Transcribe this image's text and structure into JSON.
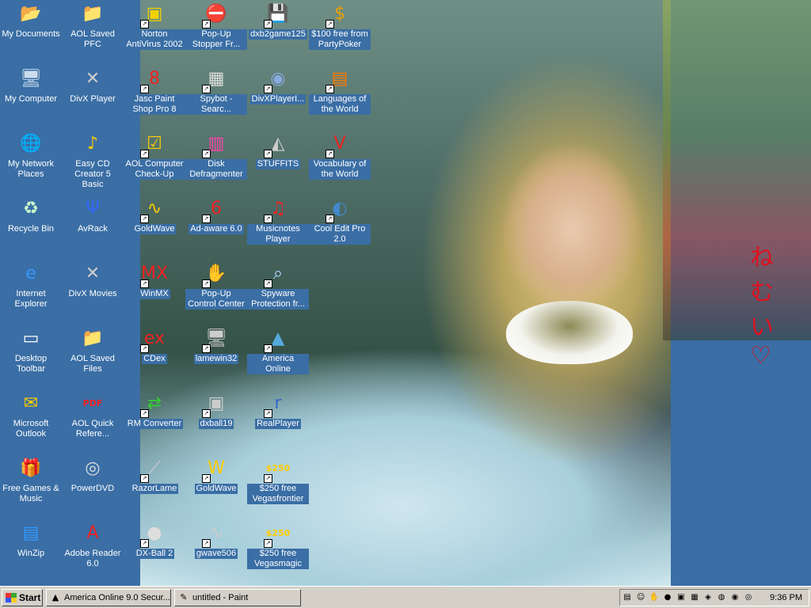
{
  "desktop": {
    "background_color": "#3a6ea5",
    "wallpaper_text": "ねむい♡",
    "icons": [
      {
        "label": "My Documents",
        "icon": "folder-documents-icon",
        "glyph": "📂",
        "color": "#f5d36a"
      },
      {
        "label": "AOL Saved PFC",
        "icon": "folder-icon",
        "glyph": "📁",
        "color": "#f5d36a"
      },
      {
        "label": "Norton AntiVirus 2002",
        "icon": "norton-icon",
        "glyph": "▣",
        "color": "#f2d200"
      },
      {
        "label": "Pop-Up Stopper Fr...",
        "icon": "popup-stopper-icon",
        "glyph": "⛔",
        "color": "#e22"
      },
      {
        "label": "dxb2game125",
        "icon": "installer-icon",
        "glyph": "💾",
        "color": "#ddd"
      },
      {
        "label": "$100 free from PartyPoker",
        "icon": "casino-chip-icon",
        "glyph": "$",
        "color": "#e8a000"
      },
      {
        "label": "My Computer",
        "icon": "computer-icon",
        "glyph": "🖥",
        "color": "#cde"
      },
      {
        "label": "DivX Player",
        "icon": "divx-icon",
        "glyph": "✕",
        "color": "#ccc"
      },
      {
        "label": "Jasc Paint Shop Pro 8",
        "icon": "paintshop-icon",
        "glyph": "8",
        "color": "#e22"
      },
      {
        "label": "Spybot - Searc...",
        "icon": "spybot-icon",
        "glyph": "▦",
        "color": "#ddd"
      },
      {
        "label": "DivXPlayerI...",
        "icon": "installer-disc-icon",
        "glyph": "◉",
        "color": "#8ad"
      },
      {
        "label": "Languages of the World",
        "icon": "languages-icon",
        "glyph": "▤",
        "color": "#f70"
      },
      {
        "label": "My Network Places",
        "icon": "network-icon",
        "glyph": "🌐",
        "color": "#5ad"
      },
      {
        "label": "Easy CD Creator 5 Basic",
        "icon": "cd-creator-icon",
        "glyph": "♪",
        "color": "#fc0"
      },
      {
        "label": "AOL Computer Check-Up",
        "icon": "checkup-icon",
        "glyph": "☑",
        "color": "#fc0"
      },
      {
        "label": "Disk Defragmenter",
        "icon": "defrag-icon",
        "glyph": "▥",
        "color": "#f4a"
      },
      {
        "label": "STUFFITS",
        "icon": "stuffit-icon",
        "glyph": "◭",
        "color": "#ccc"
      },
      {
        "label": "Vocabulary of the World",
        "icon": "vocabulary-icon",
        "glyph": "V",
        "color": "#e22"
      },
      {
        "label": "Recycle Bin",
        "icon": "recycle-bin-icon",
        "glyph": "♻",
        "color": "#cfc"
      },
      {
        "label": "AvRack",
        "icon": "avrack-icon",
        "glyph": "Ψ",
        "color": "#36f"
      },
      {
        "label": "GoldWave",
        "icon": "goldwave-icon",
        "glyph": "∿",
        "color": "#fc0"
      },
      {
        "label": "Ad-aware 6.0",
        "icon": "adaware-icon",
        "glyph": "6",
        "color": "#e22"
      },
      {
        "label": "Musicnotes Player",
        "icon": "musicnotes-icon",
        "glyph": "♫",
        "color": "#e22"
      },
      {
        "label": "Cool Edit Pro 2.0",
        "icon": "cooledit-icon",
        "glyph": "◐",
        "color": "#48c"
      },
      {
        "label": "Internet Explorer",
        "icon": "ie-icon",
        "glyph": "e",
        "color": "#39f"
      },
      {
        "label": "DivX Movies",
        "icon": "divx-movies-icon",
        "glyph": "✕",
        "color": "#ccc"
      },
      {
        "label": "WinMX",
        "icon": "winmx-icon",
        "glyph": "MX",
        "color": "#e22"
      },
      {
        "label": "Pop-Up Control Center",
        "icon": "hand-stop-icon",
        "glyph": "✋",
        "color": "#e22"
      },
      {
        "label": "Spyware Protection fr...",
        "icon": "telescope-icon",
        "glyph": "⌕",
        "color": "#adf"
      },
      {
        "label": "Desktop Toolbar",
        "icon": "toolbar-icon",
        "glyph": "▭",
        "color": "#fff"
      },
      {
        "label": "AOL Saved Files",
        "icon": "folder-icon",
        "glyph": "📁",
        "color": "#f5d36a"
      },
      {
        "label": "CDex",
        "icon": "cdex-icon",
        "glyph": "ex",
        "color": "#e22"
      },
      {
        "label": "lamewin32",
        "icon": "lame-icon",
        "glyph": "🖥",
        "color": "#ccc"
      },
      {
        "label": "America Online",
        "icon": "aol-icon",
        "glyph": "▲",
        "color": "#5ad"
      },
      {
        "label": "Microsoft Outlook",
        "icon": "outlook-icon",
        "glyph": "✉",
        "color": "#fc0"
      },
      {
        "label": "AOL Quick Refere...",
        "icon": "pdf-icon",
        "glyph": "PDF",
        "color": "#e22"
      },
      {
        "label": "RM Converter",
        "icon": "rm-converter-icon",
        "glyph": "⇄",
        "color": "#3c3"
      },
      {
        "label": "dxball19",
        "icon": "dxball-installer-icon",
        "glyph": "▣",
        "color": "#ccc"
      },
      {
        "label": "RealPlayer",
        "icon": "realplayer-icon",
        "glyph": "r",
        "color": "#36c"
      },
      {
        "label": "Free Games & Music",
        "icon": "gift-icon",
        "glyph": "🎁",
        "color": "#3c3"
      },
      {
        "label": "PowerDVD",
        "icon": "dvd-icon",
        "glyph": "◎",
        "color": "#ddd"
      },
      {
        "label": "RazorLame",
        "icon": "razor-icon",
        "glyph": "⟋",
        "color": "#ccc"
      },
      {
        "label": "GoldWave",
        "icon": "goldwave-icon",
        "glyph": "W",
        "color": "#fc0"
      },
      {
        "label": "$250 free Vegasfrontier",
        "icon": "vegas-icon",
        "glyph": "$250",
        "color": "#fc0"
      },
      {
        "label": "WinZip",
        "icon": "winzip-icon",
        "glyph": "▤",
        "color": "#39f"
      },
      {
        "label": "Adobe Reader 6.0",
        "icon": "adobe-reader-icon",
        "glyph": "A",
        "color": "#e22"
      },
      {
        "label": "DX-Ball 2",
        "icon": "ball-icon",
        "glyph": "●",
        "color": "#ddd"
      },
      {
        "label": "gwave506",
        "icon": "installer-icon",
        "glyph": "∿",
        "color": "#ccc"
      },
      {
        "label": "$250 free Vegasmagic",
        "icon": "vegas-icon",
        "glyph": "$250",
        "color": "#fc0"
      }
    ]
  },
  "taskbar": {
    "start_label": "Start",
    "tasks": [
      {
        "label": "America Online 9.0 Secur...",
        "icon": "aol-icon",
        "glyph": "▲"
      },
      {
        "label": "untitled - Paint",
        "icon": "paint-icon",
        "glyph": "✎"
      }
    ],
    "tray_icons": [
      {
        "icon": "tray-notepad-icon",
        "glyph": "▤"
      },
      {
        "icon": "tray-people-icon",
        "glyph": "☺"
      },
      {
        "icon": "tray-hand-icon",
        "glyph": "✋"
      },
      {
        "icon": "tray-green-icon",
        "glyph": "●"
      },
      {
        "icon": "tray-monitor-icon",
        "glyph": "▣"
      },
      {
        "icon": "tray-picture-icon",
        "glyph": "▦"
      },
      {
        "icon": "tray-shield-icon",
        "glyph": "◈"
      },
      {
        "icon": "tray-globe-icon",
        "glyph": "◍"
      },
      {
        "icon": "tray-network-icon",
        "glyph": "◉"
      },
      {
        "icon": "tray-realplayer-icon",
        "glyph": "◎"
      }
    ],
    "clock": "9:36 PM"
  }
}
